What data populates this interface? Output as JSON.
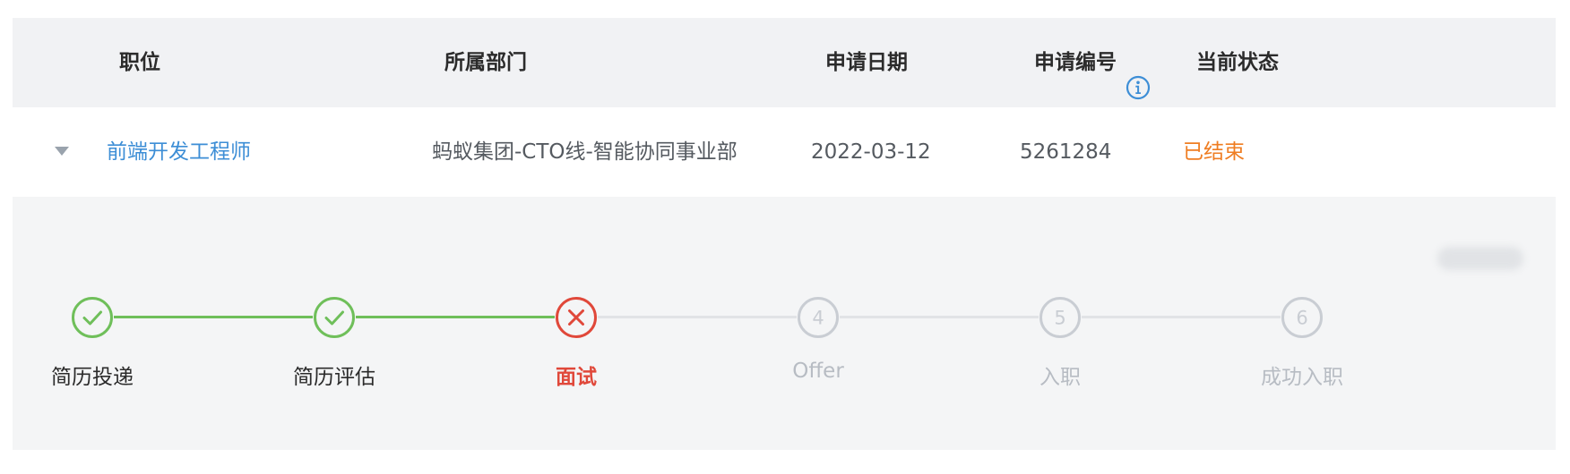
{
  "table": {
    "columns": {
      "position": "职位",
      "department": "所属部门",
      "apply_date": "申请日期",
      "apply_number": "申请编号",
      "current_status": "当前状态"
    },
    "row": {
      "position": "前端开发工程师",
      "department": "蚂蚁集团-CTO线-智能协同事业部",
      "apply_date": "2022-03-12",
      "apply_number": "5261284",
      "current_status": "已结束"
    }
  },
  "progress": {
    "steps": [
      {
        "label": "简历投递",
        "state": "done"
      },
      {
        "label": "简历评估",
        "state": "done"
      },
      {
        "label": "面试",
        "state": "failed"
      },
      {
        "label": "Offer",
        "state": "pending",
        "number": "4"
      },
      {
        "label": "入职",
        "state": "pending",
        "number": "5"
      },
      {
        "label": "成功入职",
        "state": "pending",
        "number": "6"
      }
    ]
  },
  "colors": {
    "success": "#6fbf5a",
    "failed": "#e0483a",
    "pending": "#c9cdd3",
    "link": "#3d8ed6",
    "status_ended": "#ef7d22",
    "info_icon": "#3d8ed6"
  },
  "icons": {
    "info": "info-circle-icon",
    "expand": "caret-down-icon",
    "done": "check-circle-icon",
    "failed": "close-circle-icon"
  }
}
